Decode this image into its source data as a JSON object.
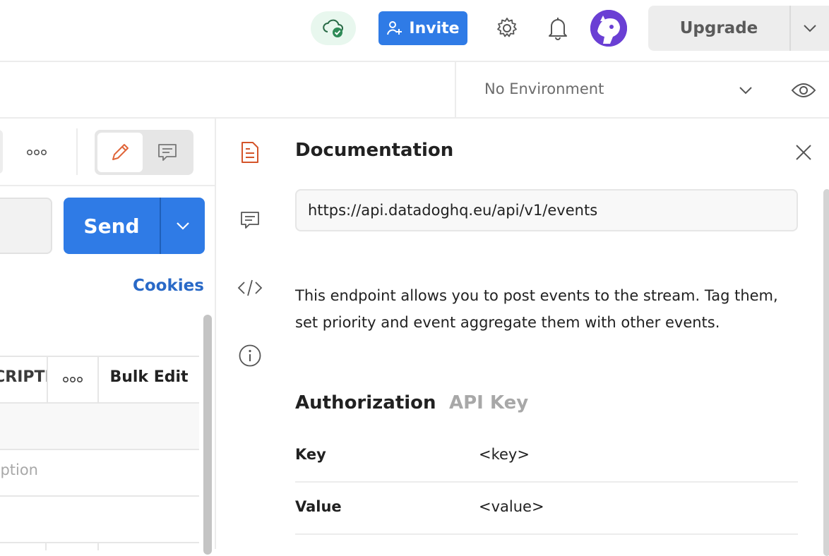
{
  "header": {
    "sync_status_icon": "cloud-check-icon",
    "invite_label": "Invite",
    "upgrade_label": "Upgrade"
  },
  "environment": {
    "selected": "No Environment"
  },
  "request": {
    "send_label": "Send",
    "cookies_label": "Cookies"
  },
  "params_table": {
    "column_description_partial": "DESCRIPTION",
    "bulk_edit_label": "Bulk Edit",
    "placeholder_partial": "ption"
  },
  "documentation": {
    "title": "Documentation",
    "url": "https://api.datadoghq.eu/api/v1/events",
    "description": "This endpoint allows you to post events to the stream. Tag them, set priority and event aggregate them with other events.",
    "authorization_title": "Authorization",
    "authorization_type": "API Key",
    "rows": [
      {
        "key": "Key",
        "value": "<key>"
      },
      {
        "key": "Value",
        "value": "<value>"
      }
    ]
  },
  "colors": {
    "accent_blue": "#2f7be6",
    "link_blue": "#2969c7",
    "doc_icon_orange": "#d4542a",
    "sync_green": "#2e8b57"
  }
}
